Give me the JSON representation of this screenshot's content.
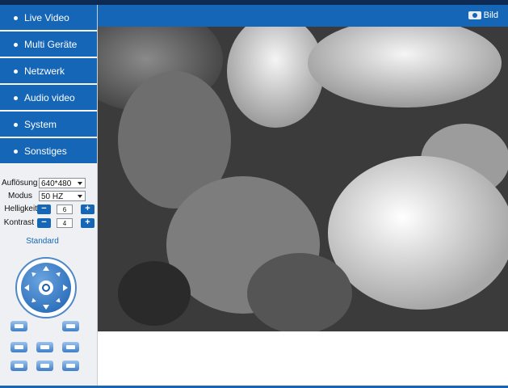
{
  "nav": {
    "items": [
      {
        "label": "Live Video"
      },
      {
        "label": "Multi Geräte"
      },
      {
        "label": "Netzwerk"
      },
      {
        "label": "Audio video"
      },
      {
        "label": "System"
      },
      {
        "label": "Sonstiges"
      }
    ]
  },
  "controls": {
    "resolution_label": "Auflösung",
    "resolution_value": "640*480",
    "mode_label": "Modus",
    "mode_value": "50 HZ",
    "brightness_label": "Helligkeit",
    "brightness_value": "6",
    "contrast_label": "Kontrast",
    "contrast_value": "4",
    "standard_label": "Standard"
  },
  "toolbar": {
    "bild_label": "Bild"
  },
  "icons": {
    "minus": "minus-icon",
    "plus": "plus-icon",
    "camera": "camera-icon"
  },
  "colors": {
    "accent": "#1566b7",
    "sidebar_bg": "#eef0f3",
    "top_strip": "#0d2a55"
  }
}
